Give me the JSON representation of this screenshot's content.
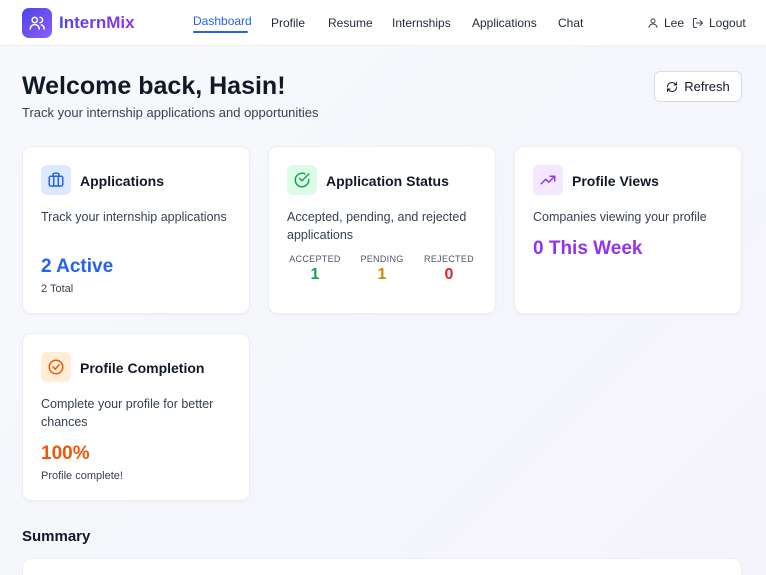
{
  "nav": {
    "brand": "InternMix",
    "links": [
      "Dashboard",
      "Profile",
      "Resume",
      "Internships",
      "Applications",
      "Chat"
    ],
    "active": "Dashboard",
    "user": "Lee",
    "logout": "Logout"
  },
  "header": {
    "title": "Welcome back, Hasin!",
    "subtitle": "Track your internship applications and opportunities",
    "refresh_label": "Refresh"
  },
  "cards": {
    "applications": {
      "title": "Applications",
      "description": "Track your internship applications",
      "value": "2 Active",
      "note": "2 Total",
      "icon": "briefcase-icon",
      "color": "#2563eb",
      "icon_bg": "#dbeafe"
    },
    "status": {
      "title": "Application Status",
      "description": "Accepted, pending, and rejected applications",
      "icon": "check-circle-icon",
      "icon_bg": "#dcfce7",
      "stats": {
        "accepted": {
          "label": "ACCEPTED",
          "value": "1",
          "color": "#16a34a"
        },
        "pending": {
          "label": "PENDING",
          "value": "1",
          "color": "#ca8a04"
        },
        "rejected": {
          "label": "REJECTED",
          "value": "0",
          "color": "#dc2626"
        }
      }
    },
    "views": {
      "title": "Profile Views",
      "description": "Companies viewing your profile",
      "value": "0 This Week",
      "icon": "trending-up-icon",
      "color": "#9333ea",
      "icon_bg": "#f3e8ff"
    },
    "completion": {
      "title": "Profile Completion",
      "description": "Complete your profile for better chances",
      "value": "100%",
      "note": "Profile complete!",
      "icon": "check-badge-icon",
      "color": "#ea580c",
      "icon_bg": "#ffedd5"
    }
  },
  "summary": {
    "title": "Summary"
  }
}
